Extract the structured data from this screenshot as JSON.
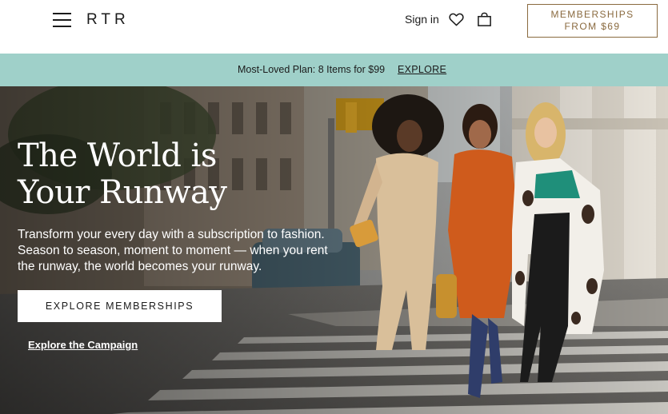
{
  "header": {
    "logo": "RTR",
    "signin_label": "Sign in",
    "membership_line1": "MEMBERSHIPS",
    "membership_line2": "FROM $69",
    "icons": [
      "hamburger-menu-icon",
      "heart-icon",
      "shopping-bag-icon"
    ]
  },
  "promo": {
    "text": "Most-Loved Plan: 8 Items for $99",
    "link": "EXPLORE"
  },
  "hero": {
    "title": "The World is Your Runway",
    "subtitle": "Transform your every day with a subscription to fashion. Season to season, moment to moment — when you rent the runway, the world becomes your runway.",
    "cta_label": "EXPLORE MEMBERSHIPS",
    "campaign_link": "Explore the Campaign"
  },
  "colors": {
    "accent_gold": "#8a6a3f",
    "promo_bg": "#9fd0c9",
    "text": "#1b1b1b"
  }
}
